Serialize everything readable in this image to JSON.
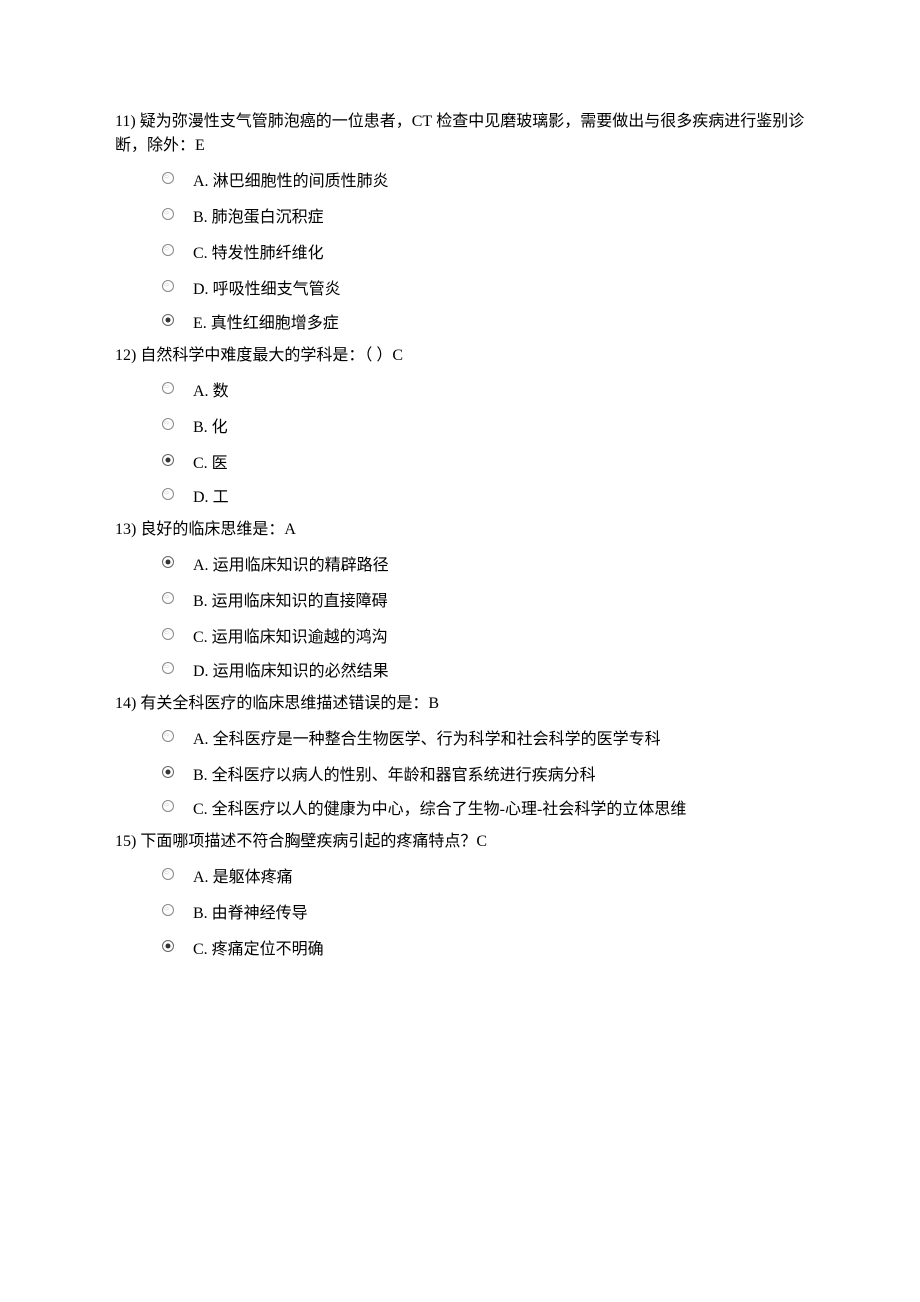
{
  "questions": [
    {
      "number": "11)",
      "text_pre": "疑为弥漫性支气管肺泡癌的一位患者，",
      "text_en": "CT",
      "text_post": " 检查中见磨玻璃影，需要做出与很多疾病进行鉴别诊断，除外：",
      "answer_suffix": "E",
      "options": [
        {
          "letter": "A.",
          "text": "淋巴细胞性的间质性肺炎",
          "selected": false
        },
        {
          "letter": "B.",
          "text": "肺泡蛋白沉积症",
          "selected": false
        },
        {
          "letter": "C.",
          "text": "特发性肺纤维化",
          "selected": false
        },
        {
          "letter": "D.",
          "text": "呼吸性细支气管炎",
          "selected": false
        },
        {
          "letter": "E.",
          "text": "真性红细胞增多症",
          "selected": true
        }
      ]
    },
    {
      "number": "12)",
      "text_pre": "自然科学中难度最大的学科是：（  ）",
      "text_en": "",
      "text_post": "",
      "answer_suffix": "C",
      "options": [
        {
          "letter": "A.",
          "text": " 数",
          "selected": false
        },
        {
          "letter": "B.",
          "text": " 化",
          "selected": false
        },
        {
          "letter": "C.",
          "text": " 医",
          "selected": true
        },
        {
          "letter": "D.",
          "text": " 工",
          "selected": false
        }
      ]
    },
    {
      "number": "13)",
      "text_pre": "良好的临床思维是：",
      "text_en": "",
      "text_post": "",
      "answer_suffix": "A",
      "options": [
        {
          "letter": "A.",
          "text": "运用临床知识的精辟路径",
          "selected": true
        },
        {
          "letter": "B.",
          "text": "运用临床知识的直接障碍",
          "selected": false
        },
        {
          "letter": "C.",
          "text": "运用临床知识逾越的鸿沟",
          "selected": false
        },
        {
          "letter": "D.",
          "text": "运用临床知识的必然结果",
          "selected": false
        }
      ]
    },
    {
      "number": "14)",
      "text_pre": "有关全科医疗的临床思维描述错误的是：",
      "text_en": "",
      "text_post": "",
      "answer_suffix": "B",
      "options": [
        {
          "letter": "A.",
          "text": "全科医疗是一种整合生物医学、行为科学和社会科学的医学专科",
          "selected": false
        },
        {
          "letter": "B.",
          "text": "全科医疗以病人的性别、年龄和器官系统进行疾病分科",
          "selected": true
        },
        {
          "letter": "C.",
          "text": "全科医疗以人的健康为中心，综合了生物-心理-社会科学的立体思维",
          "selected": false
        }
      ]
    },
    {
      "number": "15)",
      "text_pre": "下面哪项描述不符合胸壁疾病引起的疼痛特点？",
      "text_en": "",
      "text_post": "",
      "answer_suffix": "C",
      "options": [
        {
          "letter": "A.",
          "text": " 是躯体疼痛",
          "selected": false
        },
        {
          "letter": "B.",
          "text": " 由脊神经传导",
          "selected": false
        },
        {
          "letter": "C.",
          "text": " 疼痛定位不明确",
          "selected": true
        }
      ]
    }
  ]
}
